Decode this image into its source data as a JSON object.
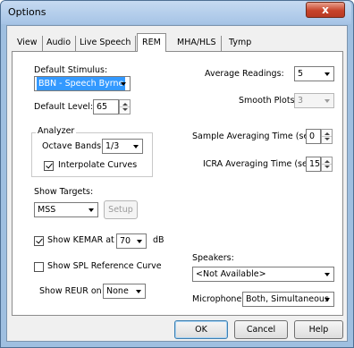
{
  "window": {
    "title": "Options",
    "close_glyph": "x"
  },
  "tabs": [
    {
      "label": "View",
      "selected": false
    },
    {
      "label": "Audio",
      "selected": false
    },
    {
      "label": "Live Speech",
      "selected": false
    },
    {
      "label": "REM",
      "selected": true
    },
    {
      "label": "MHA/HLS",
      "selected": false
    },
    {
      "label": "Tymp",
      "selected": false
    }
  ],
  "rem": {
    "default_stimulus": {
      "label": "Default Stimulus:",
      "value": "BBN - Speech Byrne"
    },
    "default_level": {
      "label": "Default Level:",
      "value": "65"
    },
    "analyzer": {
      "title": "Analyzer",
      "octave_bands": {
        "label": "Octave Bands:",
        "value": "1/3"
      },
      "interpolate_curves": {
        "label": "Interpolate Curves",
        "checked": true
      }
    },
    "show_targets": {
      "label": "Show Targets:",
      "value": "MSS",
      "setup_label": "Setup"
    },
    "show_kemar": {
      "label": "Show KEMAR at",
      "checked": true,
      "value": "70",
      "unit": "dB"
    },
    "show_spl_reference": {
      "label": "Show SPL Reference Curve",
      "checked": false
    },
    "show_reur": {
      "label": "Show REUR on",
      "value": "None"
    },
    "average_readings": {
      "label": "Average Readings:",
      "value": "5"
    },
    "smooth_plots": {
      "label": "Smooth Plots:",
      "value": "3",
      "disabled": true
    },
    "sample_averaging_time": {
      "label": "Sample Averaging Time (sec):",
      "value": "0"
    },
    "icra_averaging_time": {
      "label": "ICRA Averaging Time (sec):",
      "value": "15"
    },
    "speakers": {
      "label": "Speakers:",
      "value": "<Not Available>"
    },
    "microphone": {
      "label": "Microphone:",
      "value": "Both, Simultaneous"
    }
  },
  "footer": {
    "ok_label": "OK",
    "cancel_label": "Cancel",
    "help_label": "Help"
  }
}
